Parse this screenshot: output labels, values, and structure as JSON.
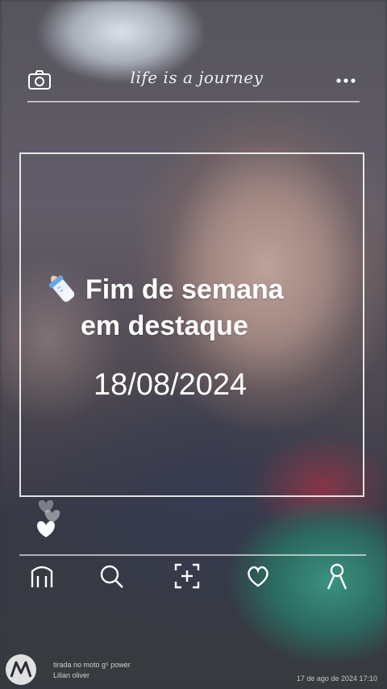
{
  "header": {
    "tagline": "life is a journey",
    "camera_icon": "camera-icon",
    "more_icon": "more-dots-icon"
  },
  "post": {
    "title_line1": "Fim de semana",
    "title_line2": "em destaque",
    "date": "18/08/2024",
    "emoji_icon": "baby-bottle-icon"
  },
  "nav": {
    "items": [
      {
        "name": "home",
        "icon": "home-icon"
      },
      {
        "name": "search",
        "icon": "search-icon"
      },
      {
        "name": "add",
        "icon": "add-square-icon"
      },
      {
        "name": "likes",
        "icon": "heart-icon"
      },
      {
        "name": "profile",
        "icon": "profile-icon"
      }
    ]
  },
  "watermark": {
    "device": "tirada no moto g⁵ power",
    "author": "Lilian oliver",
    "timestamp": "17 de ago de 2024 17:10"
  },
  "colors": {
    "overlay_line": "#ffffff",
    "text": "#ffffff"
  }
}
